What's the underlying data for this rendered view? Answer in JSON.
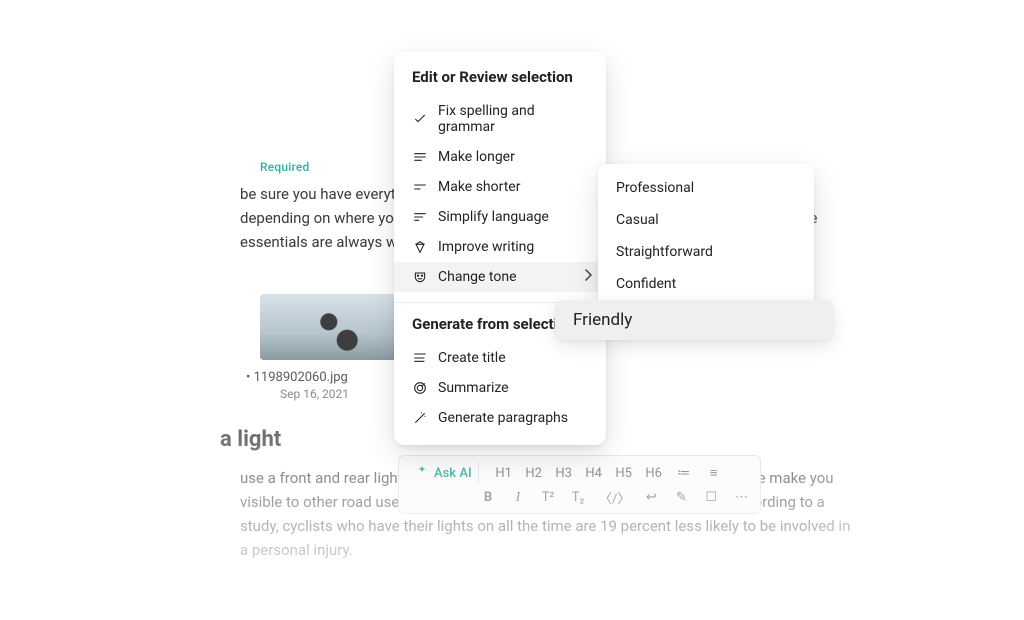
{
  "background": {
    "required_label": "Required",
    "paragraph_top": "be sure you have everything you need before heading out. Of course, your list will vary depending on where you're going, how long you're riding out, and so on. However, some essentials are always worth carrying.",
    "image_filename": "• 1198902060.jpg",
    "image_date": "Sep 16, 2021",
    "heading_lower": "a light",
    "paragraph_lower": "use a front and rear light when you're riding on public roads. Lights on your bike make you visible to other road users regardless of the light and weather conditions. According to a study, cyclists who have their lights on all the time are 19 percent less likely to be involved in a personal injury."
  },
  "toolbar": {
    "ask_ai": "Ask AI",
    "row1": [
      "H1",
      "H2",
      "H3",
      "H4",
      "H5",
      "H6",
      "≔",
      "≡"
    ],
    "row2": [
      "B",
      "I",
      "T²",
      "T₂",
      "〈/〉",
      "↩",
      "✎",
      "☐",
      "⋯"
    ]
  },
  "popover": {
    "edit_heading": "Edit or Review selection",
    "items_edit": [
      {
        "id": "fix",
        "label": "Fix spelling and grammar",
        "icon": "check-icon"
      },
      {
        "id": "longer",
        "label": "Make longer",
        "icon": "lines-long-icon"
      },
      {
        "id": "shorter",
        "label": "Make shorter",
        "icon": "lines-short-icon"
      },
      {
        "id": "simplify",
        "label": "Simplify language",
        "icon": "lines-simplify-icon"
      },
      {
        "id": "improve",
        "label": "Improve writing",
        "icon": "diamond-icon"
      },
      {
        "id": "tone",
        "label": "Change tone",
        "icon": "mask-icon",
        "submenu": true
      }
    ],
    "generate_heading": "Generate from selection",
    "items_generate": [
      {
        "id": "title",
        "label": "Create title",
        "icon": "title-icon"
      },
      {
        "id": "summarize",
        "label": "Summarize",
        "icon": "target-icon"
      },
      {
        "id": "paragraphs",
        "label": "Generate paragraphs",
        "icon": "wand-icon"
      }
    ]
  },
  "submenu": {
    "items": [
      "Professional",
      "Casual",
      "Straightforward",
      "Confident"
    ]
  },
  "highlight": {
    "label": "Friendly"
  }
}
